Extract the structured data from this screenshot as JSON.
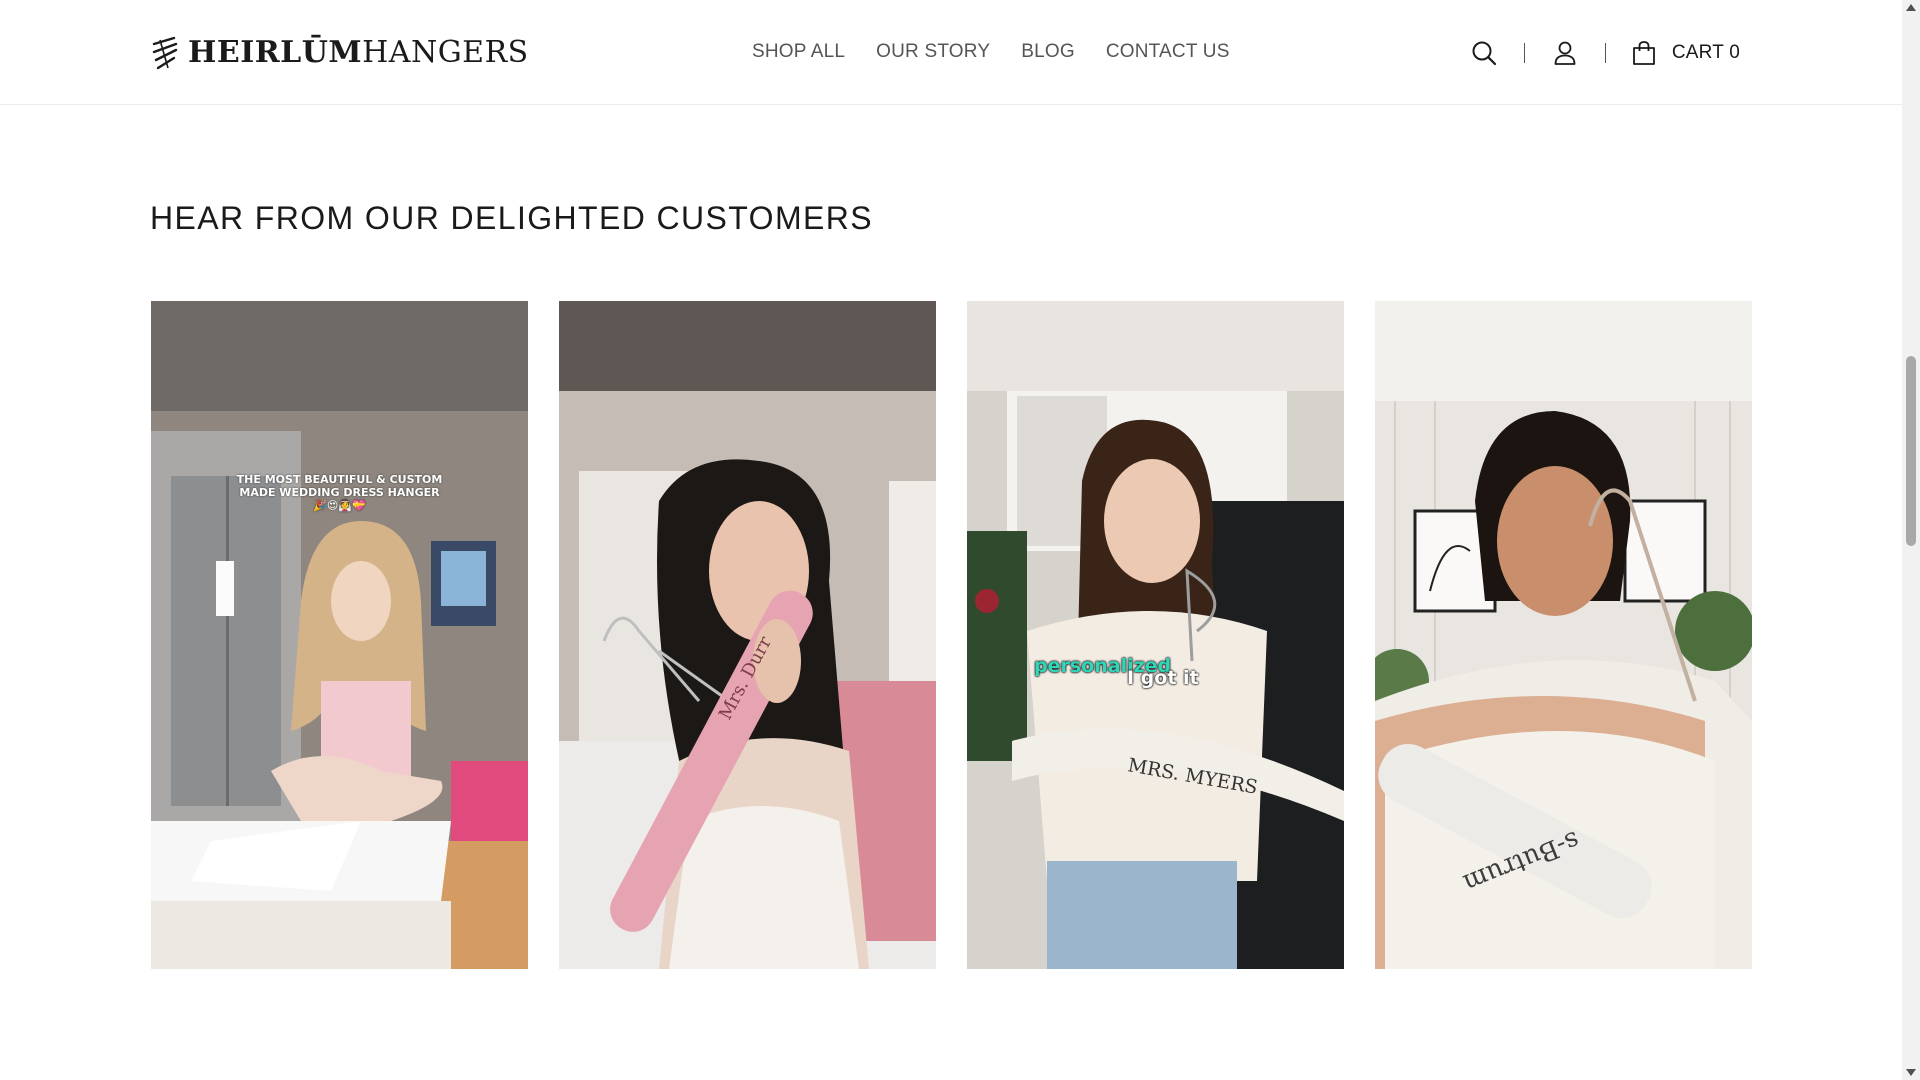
{
  "brand": {
    "name_part1": "HEIRLŪM",
    "name_part2": "HANGERS"
  },
  "nav": {
    "items": [
      {
        "label": "SHOP ALL"
      },
      {
        "label": "OUR STORY"
      },
      {
        "label": "BLOG"
      },
      {
        "label": "CONTACT US"
      }
    ]
  },
  "header_tools": {
    "search_icon": "search-icon",
    "account_icon": "user-icon",
    "cart_icon": "shopping-bag-icon",
    "cart_label": "CART",
    "cart_count": "0"
  },
  "testimonials": {
    "title": "HEAR FROM OUR DELIGHTED CUSTOMERS",
    "videos": [
      {
        "caption_line1": "THE MOST BEAUTIFUL & CUSTOM",
        "caption_line2": "MADE WEDDING DRESS HANGER",
        "caption_emoji": "🎉😍👰💝"
      },
      {
        "hanger_text": "Mrs. Durr"
      },
      {
        "overlay_word1": "personalized",
        "overlay_word2": "I got it",
        "hanger_text": "MRS. MYERS"
      },
      {
        "hanger_text": "s-Butrum"
      }
    ]
  },
  "colors": {
    "text_primary": "#1a1a1a",
    "nav_text": "#555555",
    "caption_teal": "#2fd6b8",
    "pink_hanger": "#e6a3b1",
    "white_hanger": "#f2efe9"
  }
}
